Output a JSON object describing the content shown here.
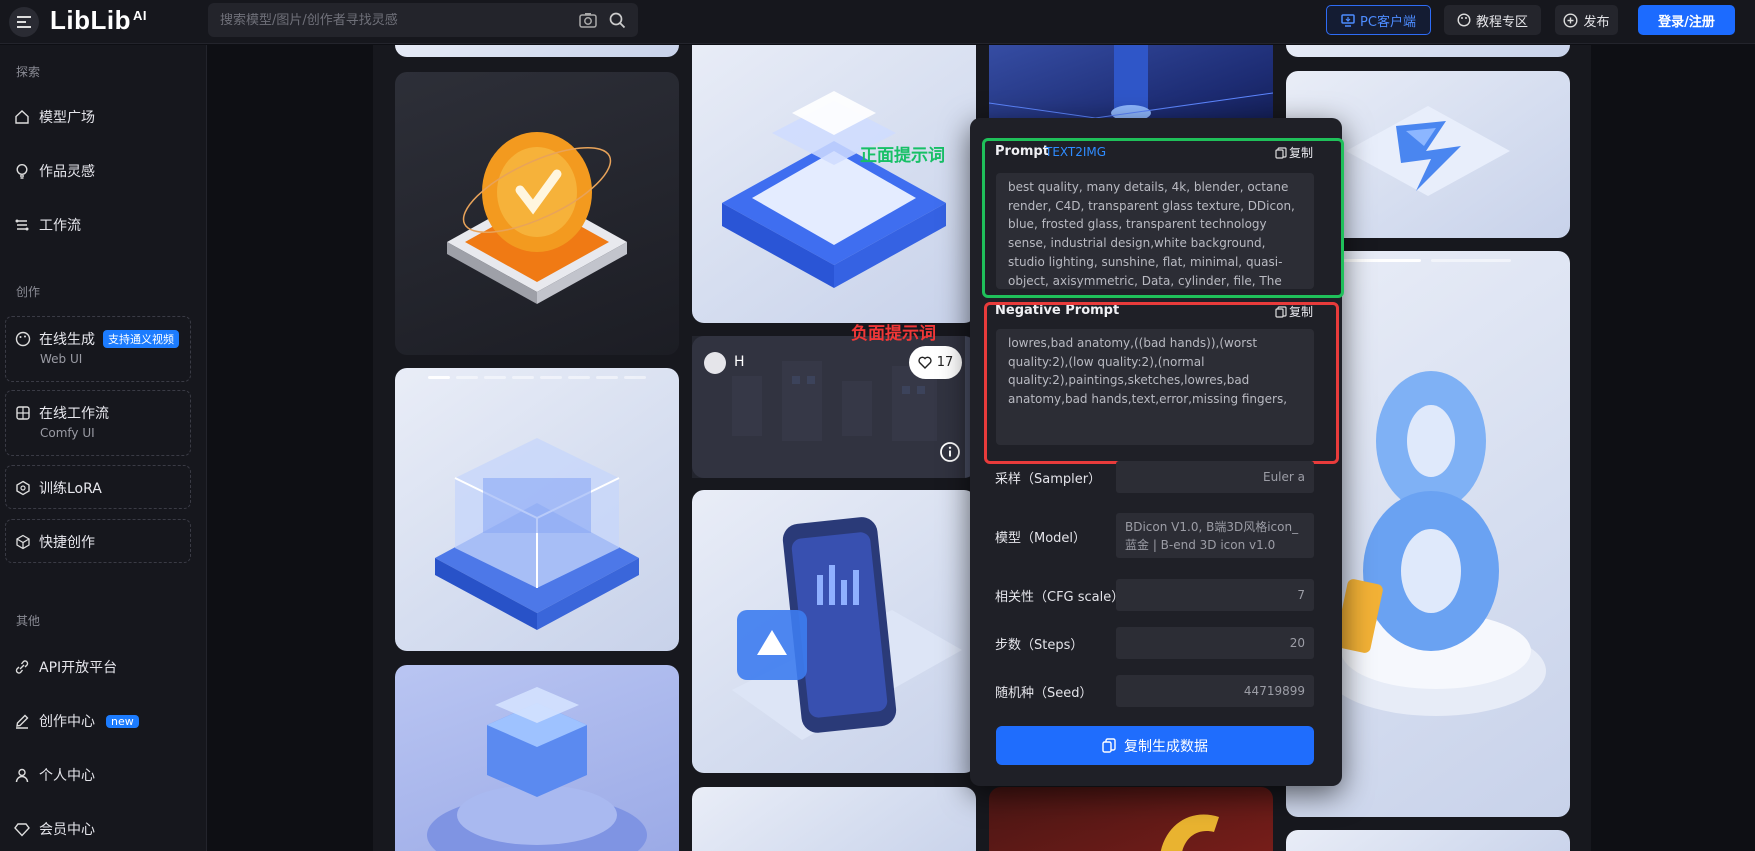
{
  "header": {
    "logo_text": "LibLib",
    "logo_ai": "AI",
    "search_placeholder": "搜索模型/图片/创作者寻找灵感",
    "pc_client": "PC客户端",
    "tutorials": "教程专区",
    "publish": "发布",
    "login": "登录/注册"
  },
  "sidebar": {
    "explore_title": "探索",
    "model_square": "模型广场",
    "inspiration": "作品灵感",
    "workflow": "工作流",
    "create_title": "创作",
    "online_gen": "在线生成",
    "online_gen_badge": "支持通义视频",
    "online_gen_sub": "Web UI",
    "online_workflow": "在线工作流",
    "online_workflow_sub": "Comfy UI",
    "train_lora": "训练LoRA",
    "quick_create": "快捷创作",
    "other_title": "其他",
    "api": "API开放平台",
    "creator_center": "创作中心",
    "creator_badge": "new",
    "personal_center": "个人中心",
    "member_center": "会员中心"
  },
  "gallery": {
    "user_initial": "H",
    "like_count": "17"
  },
  "panel": {
    "prompt_label": "Prompt",
    "prompt_tag": "TEXT2IMG",
    "copy_label": "复制",
    "prompt_text": "best quality, many details, 4k, blender, octane render, C4D, transparent glass texture, DDicon, blue, frosted glass, transparent technology sense, industrial design,white background, studio lighting, sunshine, flat, minimal, quasi-object, axisymmetric, Data, cylinder, file, The background elements are",
    "negative_label": "Negative Prompt",
    "negative_copy": "复制",
    "negative_text": "lowres,bad anatomy,((bad hands)),(worst quality:2),(low quality:2),(normal quality:2),paintings,sketches,lowres,bad anatomy,bad hands,text,error,missing fingers,",
    "sampler_label": "采样（Sampler）",
    "sampler_value": "Euler a",
    "model_label": "模型（Model）",
    "model_value": "BDicon V1.0, B端3D风格icon_蓝金 | B-end 3D icon v1.0",
    "cfg_label": "相关性（CFG scale）",
    "cfg_value": "7",
    "steps_label": "步数（Steps）",
    "steps_value": "20",
    "seed_label": "随机种（Seed）",
    "seed_value": "44719899",
    "copy_gen_data": "复制生成数据"
  },
  "annotations": {
    "positive": "正面提示词",
    "negative": "负面提示词"
  }
}
